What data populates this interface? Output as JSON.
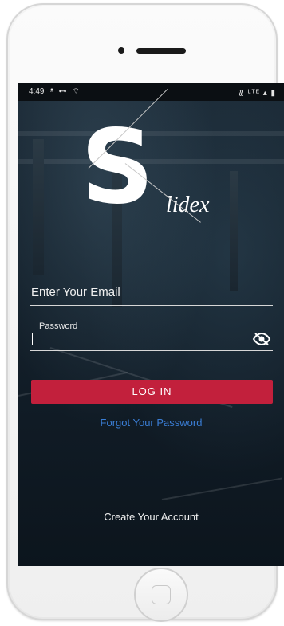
{
  "status_bar": {
    "time": "4:49",
    "left_icons": "ᵜ ⊷ ⌔",
    "right_icons": "᯾ ᴸᵀᴱ ▴ ▮"
  },
  "logo": {
    "letter": "S",
    "word": "lidex"
  },
  "login_form": {
    "email_placeholder": "Enter Your Email",
    "password_label": "Password",
    "login_button": "LOG IN",
    "forgot_link": "Forgot Your Password",
    "create_link": "Create Your Account"
  },
  "colors": {
    "accent_button": "#c2203c",
    "link": "#3a7dd4",
    "background": "#0f1a24"
  },
  "icons": {
    "password_visibility": "eye-off-icon"
  }
}
